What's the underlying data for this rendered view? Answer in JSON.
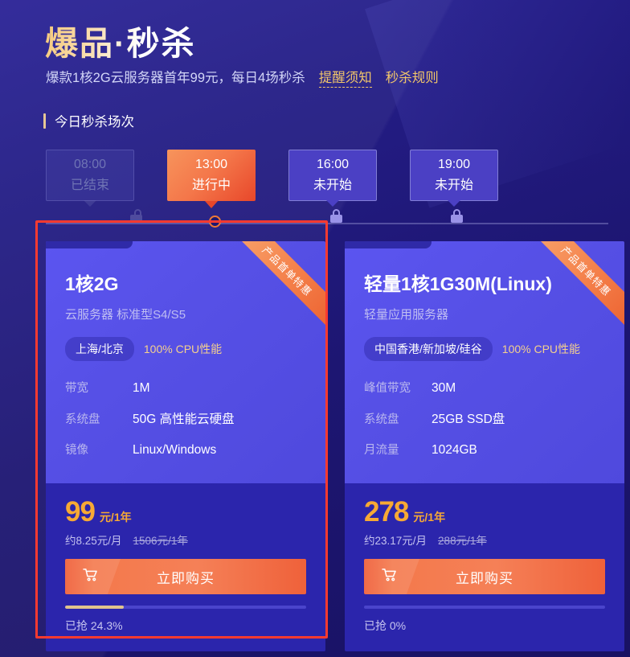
{
  "header": {
    "title": "爆品·秒杀",
    "subtitle": "爆款1核2G云服务器首年99元，每日4场秒杀",
    "links": [
      {
        "label": "提醒须知",
        "dashed": true
      },
      {
        "label": "秒杀规则",
        "dashed": false
      }
    ],
    "section_title": "今日秒杀场次",
    "accent_gold": "#f2c66a",
    "accent_orange": "#f07a35",
    "selection_red": "#f93a30"
  },
  "sessions": [
    {
      "time": "08:00",
      "state": "已结束",
      "status": "ended",
      "lock": "unlock-icon"
    },
    {
      "time": "13:00",
      "state": "进行中",
      "status": "active",
      "lock": "ring-marker"
    },
    {
      "time": "16:00",
      "state": "未开始",
      "status": "upcoming",
      "lock": "lock-icon"
    },
    {
      "time": "19:00",
      "state": "未开始",
      "status": "upcoming",
      "lock": "lock-icon"
    }
  ],
  "cards": [
    {
      "ribbon": "产品首单特惠",
      "title": "1核2G",
      "subtitle": "云服务器 标准型S4/S5",
      "region_badge": "上海/北京",
      "cpu_note": "100% CPU性能",
      "specs": [
        {
          "key": "带宽",
          "value": "1M"
        },
        {
          "key": "系统盘",
          "value": "50G 高性能云硬盘"
        },
        {
          "key": "镜像",
          "value": "Linux/Windows"
        }
      ],
      "price": "99",
      "price_unit": "元/1年",
      "price_monthly": "约8.25元/月",
      "price_original": "1506元/1年",
      "buy_label": "立即购买",
      "cart_icon": "shopping-cart-icon",
      "progress_label": "已抢 24.3%",
      "progress_percent": 24.3,
      "selected": true
    },
    {
      "ribbon": "产品首单特惠",
      "title": "轻量1核1G30M(Linux)",
      "subtitle": "轻量应用服务器",
      "region_badge": "中国香港/新加坡/硅谷",
      "cpu_note": "100% CPU性能",
      "specs": [
        {
          "key": "峰值带宽",
          "value": "30M"
        },
        {
          "key": "系统盘",
          "value": "25GB SSD盘"
        },
        {
          "key": "月流量",
          "value": "1024GB"
        }
      ],
      "price": "278",
      "price_unit": "元/1年",
      "price_monthly": "约23.17元/月",
      "price_original": "288元/1年",
      "buy_label": "立即购买",
      "cart_icon": "shopping-cart-icon",
      "progress_label": "已抢 0%",
      "progress_percent": 0,
      "selected": false
    }
  ]
}
